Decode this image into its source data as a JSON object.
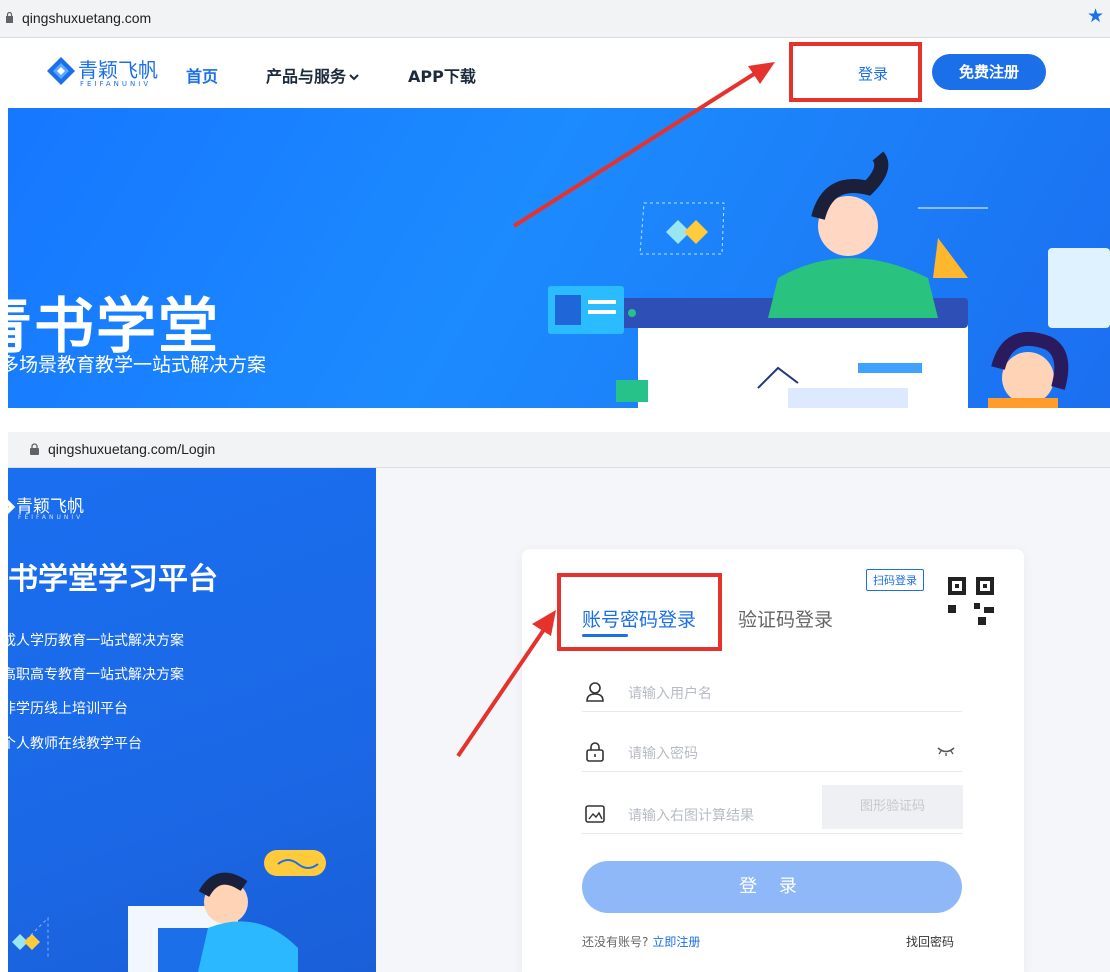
{
  "top": {
    "url": "qingshuxuetang.com",
    "logo": {
      "name": "青颖飞帆",
      "sub": "FEIFANUNIV"
    },
    "nav": [
      {
        "label": "首页"
      },
      {
        "label": "产品与服务"
      },
      {
        "label": "APP下载"
      }
    ],
    "login_label": "登录",
    "register_label": "免费注册",
    "hero": {
      "title": "青书学堂",
      "subtitle": "多场景教育教学一站式解决方案"
    }
  },
  "bottom": {
    "url": "qingshuxuetang.com/Login",
    "logo": {
      "name": "青颖飞帆",
      "sub": "FEIFANUNIV"
    },
    "panel_title": "青书学堂学习平台",
    "panel_items": [
      "成人学历教育一站式解决方案",
      "高职高专教育一站式解决方案",
      "非学历线上培训平台",
      "个人教师在线教学平台"
    ],
    "form": {
      "tab_account": "账号密码登录",
      "tab_code": "验证码登录",
      "qr_tip": "扫码登录",
      "username_ph": "请输入用户名",
      "password_ph": "请输入密码",
      "captcha_ph": "请输入右图计算结果",
      "captcha_label": "图形验证码",
      "submit_label": "登 录",
      "no_account": "还没有账号?",
      "register_link": "立即注册",
      "forgot": "找回密码"
    }
  },
  "colors": {
    "brand": "#1b6fe8",
    "highlight": "#e5322d"
  }
}
